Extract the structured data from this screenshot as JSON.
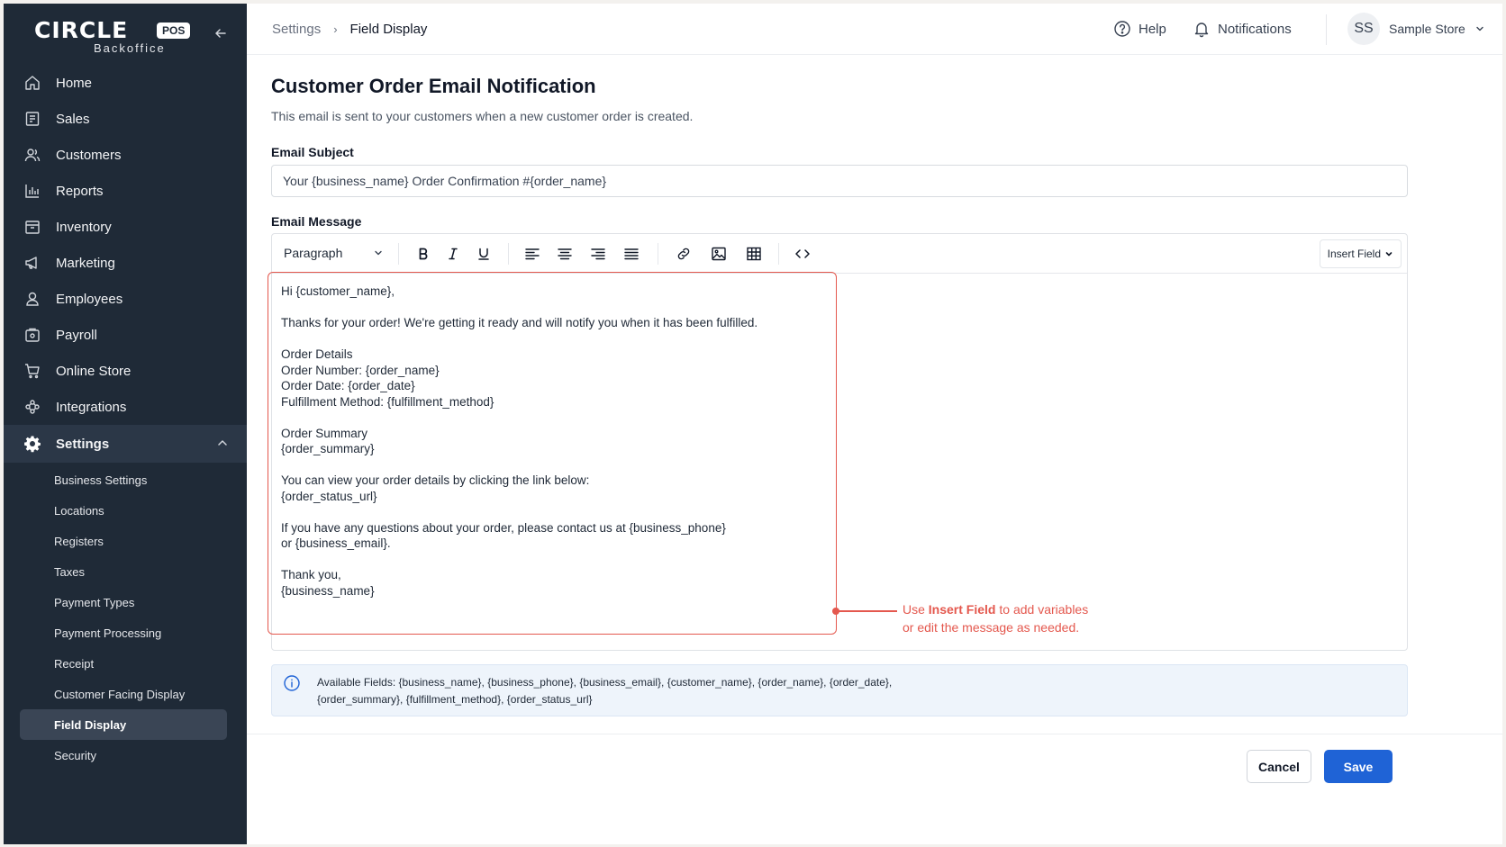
{
  "brand": {
    "name": "CIRCLE",
    "badge": "POS",
    "sub": "Backoffice"
  },
  "sidebar": {
    "items": [
      {
        "label": "Home",
        "icon": "home-icon"
      },
      {
        "label": "Sales",
        "icon": "receipt-icon"
      },
      {
        "label": "Customers",
        "icon": "users-icon"
      },
      {
        "label": "Reports",
        "icon": "bar-chart-icon"
      },
      {
        "label": "Inventory",
        "icon": "box-icon"
      },
      {
        "label": "Marketing",
        "icon": "megaphone-icon"
      },
      {
        "label": "Employees",
        "icon": "user-icon"
      },
      {
        "label": "Payroll",
        "icon": "wallet-icon"
      },
      {
        "label": "Online Store",
        "icon": "cart-icon"
      },
      {
        "label": "Integrations",
        "icon": "puzzle-icon"
      }
    ],
    "settings": {
      "label": "Settings",
      "sub_items": [
        "Business Settings",
        "Locations",
        "Registers",
        "Taxes",
        "Payment Types",
        "Payment Processing",
        "Receipt",
        "Customer Facing Display",
        "Field Display",
        "Security"
      ],
      "active": "Field Display"
    }
  },
  "topbar": {
    "breadcrumb": [
      "Settings",
      "Field Display"
    ],
    "help": "Help",
    "notifications": "Notifications",
    "avatar_initials": "SS",
    "store_name": "Sample Store"
  },
  "main": {
    "title": "Customer Order Email Notification",
    "description": "This email is sent to your customers when a new customer order is created.",
    "subject_label": "Email Subject",
    "subject_value": "Your {business_name} Order Confirmation #{order_name}",
    "message_label": "Email Message",
    "toolbar": {
      "format": "Paragraph",
      "insert_field": "Insert Field"
    },
    "message_body": "Hi {customer_name},\n\nThanks for your order! We're getting it ready and will notify you when it has been fulfilled.\n\nOrder Details\nOrder Number: {order_name}\nOrder Date: {order_date}\nFulfillment Method: {fulfillment_method}\n\nOrder Summary\n{order_summary}\n\nYou can view your order details by clicking the link below:\n{order_status_url}\n\nIf you have any questions about your order, please contact us at {business_phone}\nor {business_email}.\n\nThank you,\n{business_name}",
    "callout": {
      "pre": "Use ",
      "bold": "Insert Field",
      "post": " to add variables",
      "line2": "or edit the message as needed."
    },
    "available_fields_line1": "Available Fields: {business_name}, {business_phone}, {business_email}, {customer_name}, {order_name}, {order_date},",
    "available_fields_line2": "{order_summary}, {fulfillment_method}, {order_status_url}",
    "cancel": "Cancel",
    "save": "Save"
  },
  "colors": {
    "sidebar": "#1f2a37",
    "primary": "#1f63d6",
    "annotation": "#e4584e"
  }
}
